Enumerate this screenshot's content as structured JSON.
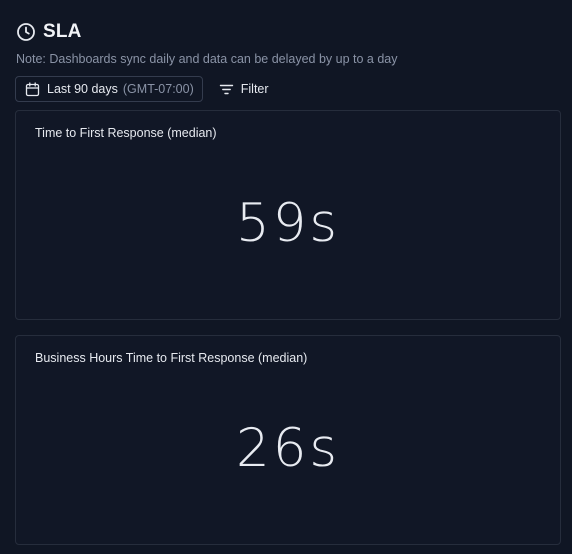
{
  "header": {
    "title": "SLA",
    "icon": "clock-icon",
    "note": "Note: Dashboards sync daily and data can be delayed by up to a day"
  },
  "toolbar": {
    "date_range_label": "Last 90 days",
    "timezone_label": "(GMT-07:00)",
    "filter_label": "Filter"
  },
  "cards": [
    {
      "title": "Time to First Response (median)",
      "value": "59s"
    },
    {
      "title": "Business Hours Time to First Response (median)",
      "value": "26s"
    }
  ],
  "colors": {
    "background": "#101624",
    "card_border": "#262d3c",
    "text_primary": "#e6e9ef",
    "text_muted": "#8a93a6"
  }
}
